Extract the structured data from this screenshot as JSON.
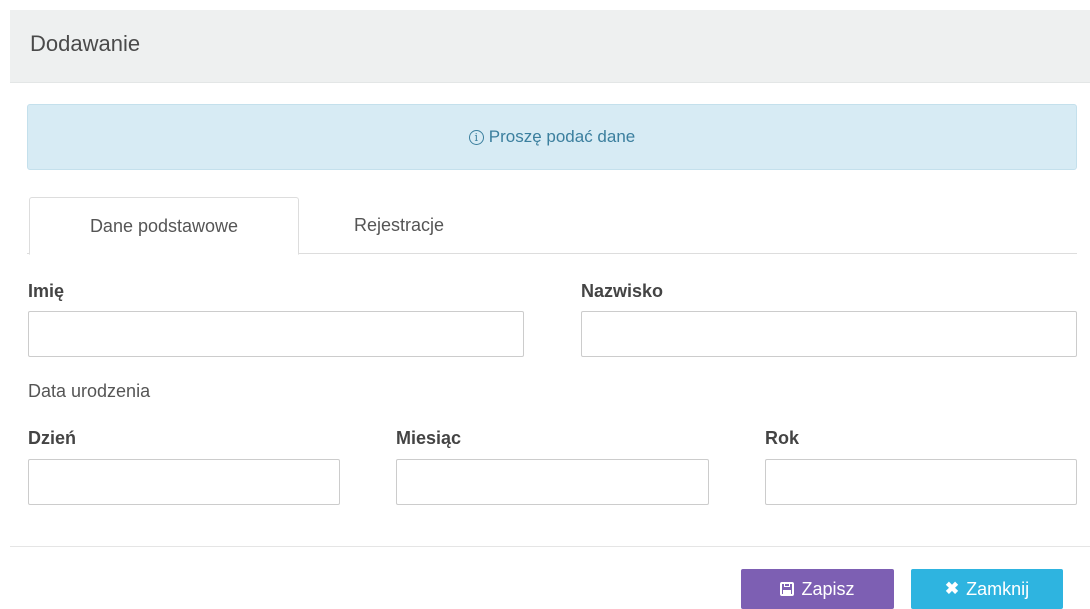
{
  "header": {
    "title": "Dodawanie"
  },
  "alert": {
    "icon": "info-icon",
    "message": "Proszę podać dane",
    "color": "#3b7f9e",
    "background": "#d7ebf4"
  },
  "tabs": [
    {
      "label": "Dane podstawowe",
      "active": true
    },
    {
      "label": "Rejestracje",
      "active": false
    }
  ],
  "form": {
    "first_name": {
      "label": "Imię",
      "value": "",
      "placeholder": ""
    },
    "last_name": {
      "label": "Nazwisko",
      "value": "",
      "placeholder": ""
    },
    "birth_date_label": "Data urodzenia",
    "day": {
      "label": "Dzień",
      "value": "",
      "placeholder": ""
    },
    "month": {
      "label": "Miesiąc",
      "value": "",
      "placeholder": ""
    },
    "year": {
      "label": "Rok",
      "value": "",
      "placeholder": ""
    }
  },
  "footer": {
    "save_label": "Zapisz",
    "save_icon": "floppy-disk-icon",
    "save_color": "#7d5fb3",
    "close_label": "Zamknij",
    "close_icon": "close-icon",
    "close_color": "#2eb4e0"
  }
}
